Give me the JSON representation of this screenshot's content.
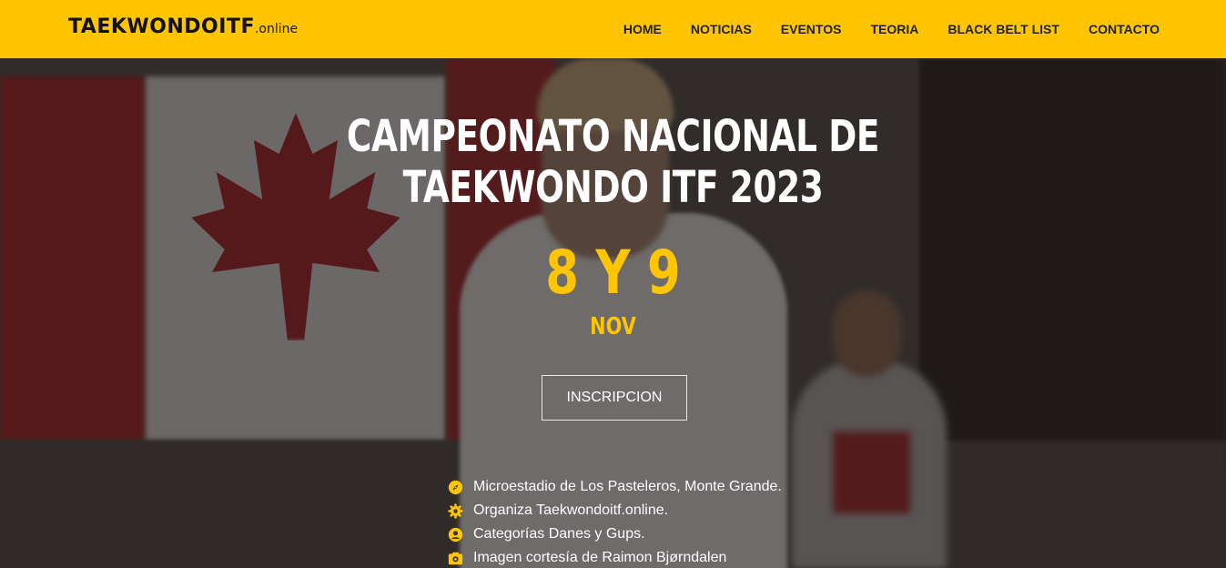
{
  "brand": {
    "name": "TAEKWONDOITF",
    "suffix": ".online"
  },
  "nav": {
    "items": [
      {
        "label": "HOME"
      },
      {
        "label": "NOTICIAS"
      },
      {
        "label": "EVENTOS"
      },
      {
        "label": "TEORIA"
      },
      {
        "label": "BLACK BELT LIST"
      },
      {
        "label": "CONTACTO"
      }
    ]
  },
  "hero": {
    "title_line1": "CAMPEONATO NACIONAL DE",
    "title_line2": "TAEKWONDO ITF 2023",
    "date_days": "8 Y 9",
    "date_month": "NOV",
    "cta_label": "INSCRIPCION",
    "info": [
      {
        "icon": "compass-icon",
        "text": "Microestadio de Los Pasteleros, Monte Grande."
      },
      {
        "icon": "gear-icon",
        "text": "Organiza Taekwondoitf.online."
      },
      {
        "icon": "user-icon",
        "text": "Categorías Danes y Gups."
      },
      {
        "icon": "camera-icon",
        "text": "Imagen cortesía de Raimon Bjørndalen"
      }
    ]
  },
  "colors": {
    "accent": "#ffc500",
    "nav_text": "#222222",
    "hero_text": "#ffffff"
  }
}
